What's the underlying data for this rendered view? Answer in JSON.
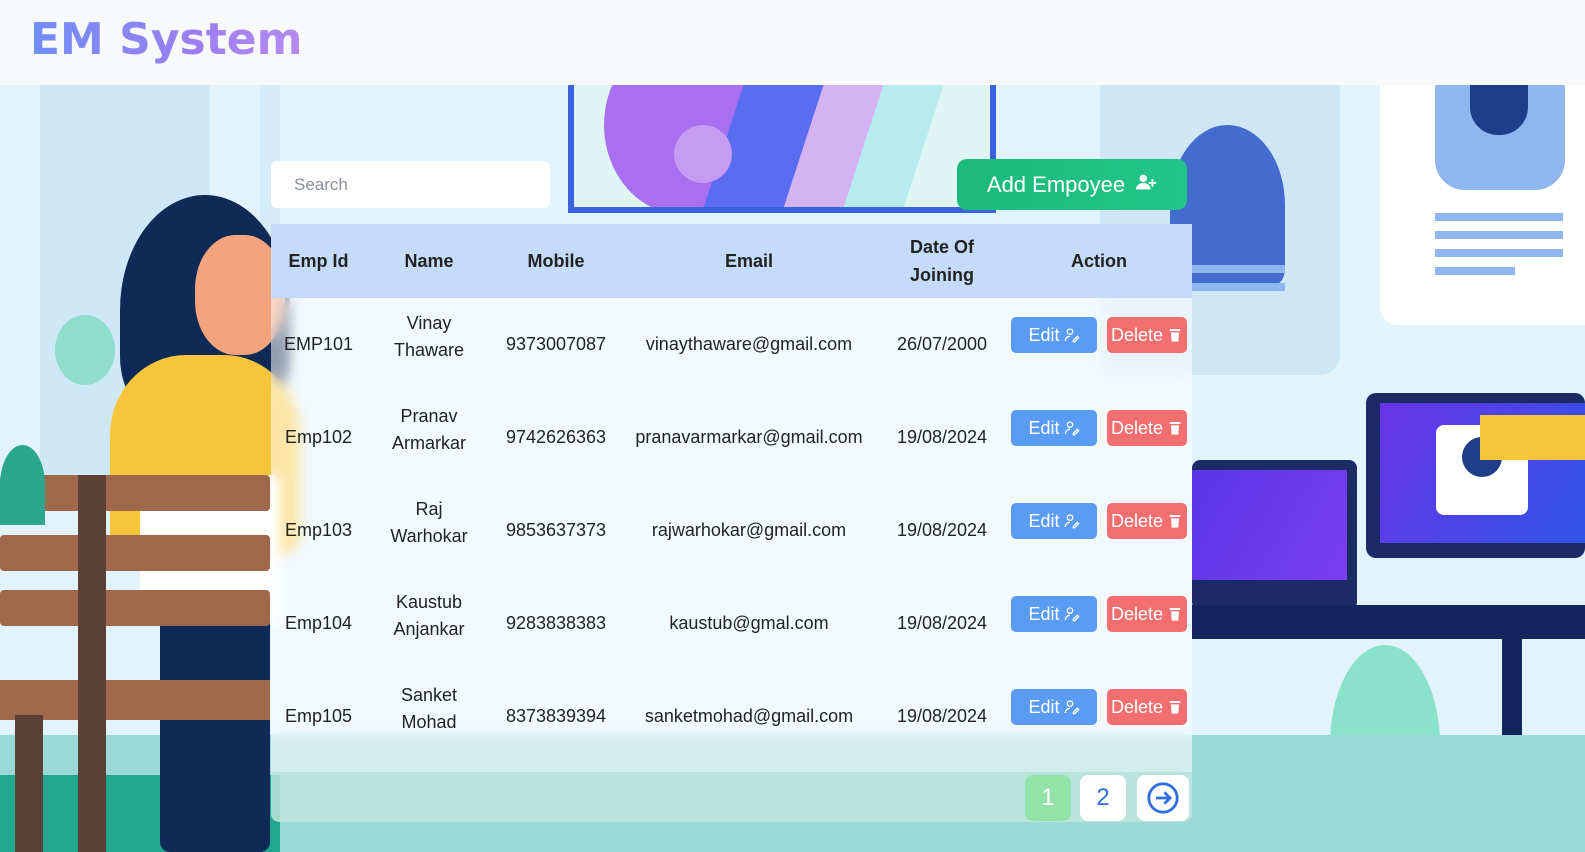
{
  "app": {
    "title": "EM System"
  },
  "toolbar": {
    "search_placeholder": "Search",
    "add_label": "Add Empoyee"
  },
  "table": {
    "headers": [
      "Emp Id",
      "Name",
      "Mobile",
      "Email",
      "Date Of Joining",
      "Action"
    ],
    "rows": [
      {
        "id": "EMP101",
        "name": "Vinay Thaware",
        "mobile": "9373007087",
        "email": "vinaythaware@gmail.com",
        "doj": "26/07/2000"
      },
      {
        "id": "Emp102",
        "name": "Pranav Armarkar",
        "mobile": "9742626363",
        "email": "pranavarmarkar@gmail.com",
        "doj": "19/08/2024"
      },
      {
        "id": "Emp103",
        "name": "Raj Warhokar",
        "mobile": "9853637373",
        "email": "rajwarhokar@gmail.com",
        "doj": "19/08/2024"
      },
      {
        "id": "Emp104",
        "name": "Kaustub Anjankar",
        "mobile": "9283838383",
        "email": "kaustub@gmal.com",
        "doj": "19/08/2024"
      },
      {
        "id": "Emp105",
        "name": "Sanket Mohad",
        "mobile": "8373839394",
        "email": "sanketmohad@gmail.com",
        "doj": "19/08/2024"
      }
    ],
    "edit_label": "Edit",
    "delete_label": "Delete"
  },
  "pagination": {
    "pages": [
      "1",
      "2"
    ],
    "current": "1",
    "next_icon": "arrow-right-circle-icon"
  },
  "colors": {
    "header_bg": "#c4dcfa",
    "edit": "#5a9cf4",
    "delete": "#f36f6f",
    "add": "#1bb97b",
    "page_active": "#93e3a8"
  }
}
